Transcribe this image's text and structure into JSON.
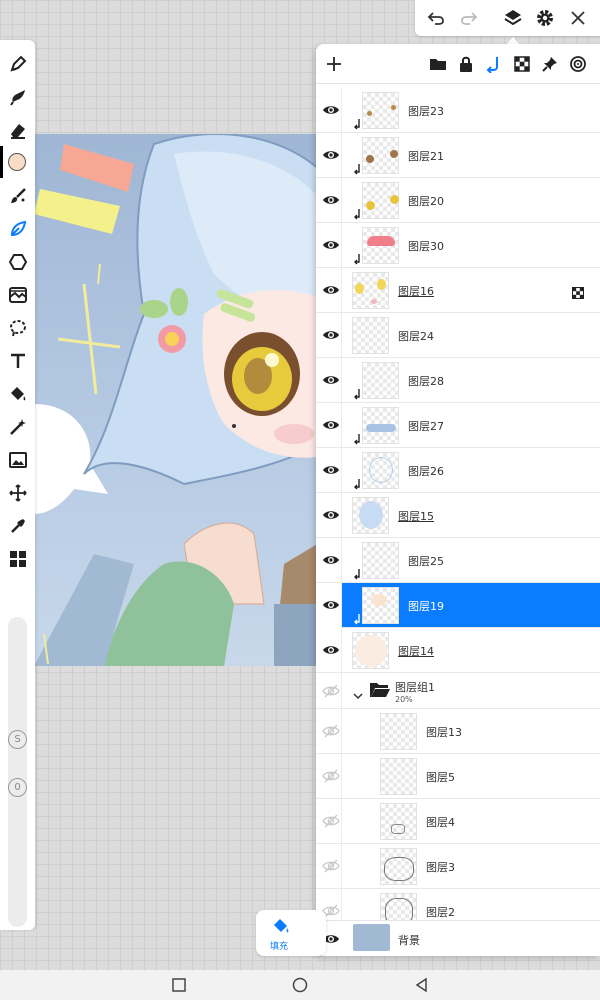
{
  "colors": {
    "accent": "#0a7cff",
    "background_color": "#a2b9d3",
    "primary_color": "#f8dcc4"
  },
  "toolbar": {
    "tools": [
      "pen-icon",
      "smudge-icon",
      "eraser-icon",
      "color-picker-swatch",
      "brush-icon",
      "leaf-brush-icon",
      "shape-icon",
      "adjust-icon",
      "lasso-icon",
      "text-icon",
      "fill-bucket-icon",
      "magic-wand-icon",
      "image-icon",
      "transform-icon",
      "eyedropper-icon",
      "grid-icon"
    ],
    "size_badge": "S",
    "opacity_badge": "0"
  },
  "topbar": {
    "icons": [
      "undo-icon",
      "redo-icon",
      "layers-icon",
      "settings-icon",
      "close-icon"
    ]
  },
  "panel_header": {
    "icons": [
      "add-layer-icon",
      "folder-icon",
      "lock-icon",
      "clip-icon",
      "transparency-icon",
      "pin-icon",
      "target-icon"
    ]
  },
  "layers": [
    {
      "name": "图层23",
      "clip": true,
      "visible": true
    },
    {
      "name": "图层21",
      "clip": true,
      "visible": true
    },
    {
      "name": "图层20",
      "clip": true,
      "visible": true
    },
    {
      "name": "图层30",
      "clip": true,
      "visible": true
    },
    {
      "name": "图层16",
      "clip": false,
      "visible": true,
      "underline": true,
      "alpha_lock": true
    },
    {
      "name": "图层24",
      "clip": false,
      "visible": true
    },
    {
      "name": "图层28",
      "clip": true,
      "visible": true
    },
    {
      "name": "图层27",
      "clip": true,
      "visible": true
    },
    {
      "name": "图层26",
      "clip": true,
      "visible": true
    },
    {
      "name": "图层15",
      "clip": false,
      "visible": true,
      "underline": true
    },
    {
      "name": "图层25",
      "clip": true,
      "visible": true
    },
    {
      "name": "图层19",
      "clip": true,
      "visible": true,
      "selected": true
    },
    {
      "name": "图层14",
      "clip": false,
      "visible": true,
      "underline": true
    }
  ],
  "group": {
    "name": "图层组1",
    "opacity": "20%",
    "children": [
      "图层13",
      "图层5",
      "图层4",
      "图层3",
      "图层2"
    ]
  },
  "background_layer": {
    "name": "背景"
  },
  "bottom_tool": {
    "label": "填充"
  }
}
